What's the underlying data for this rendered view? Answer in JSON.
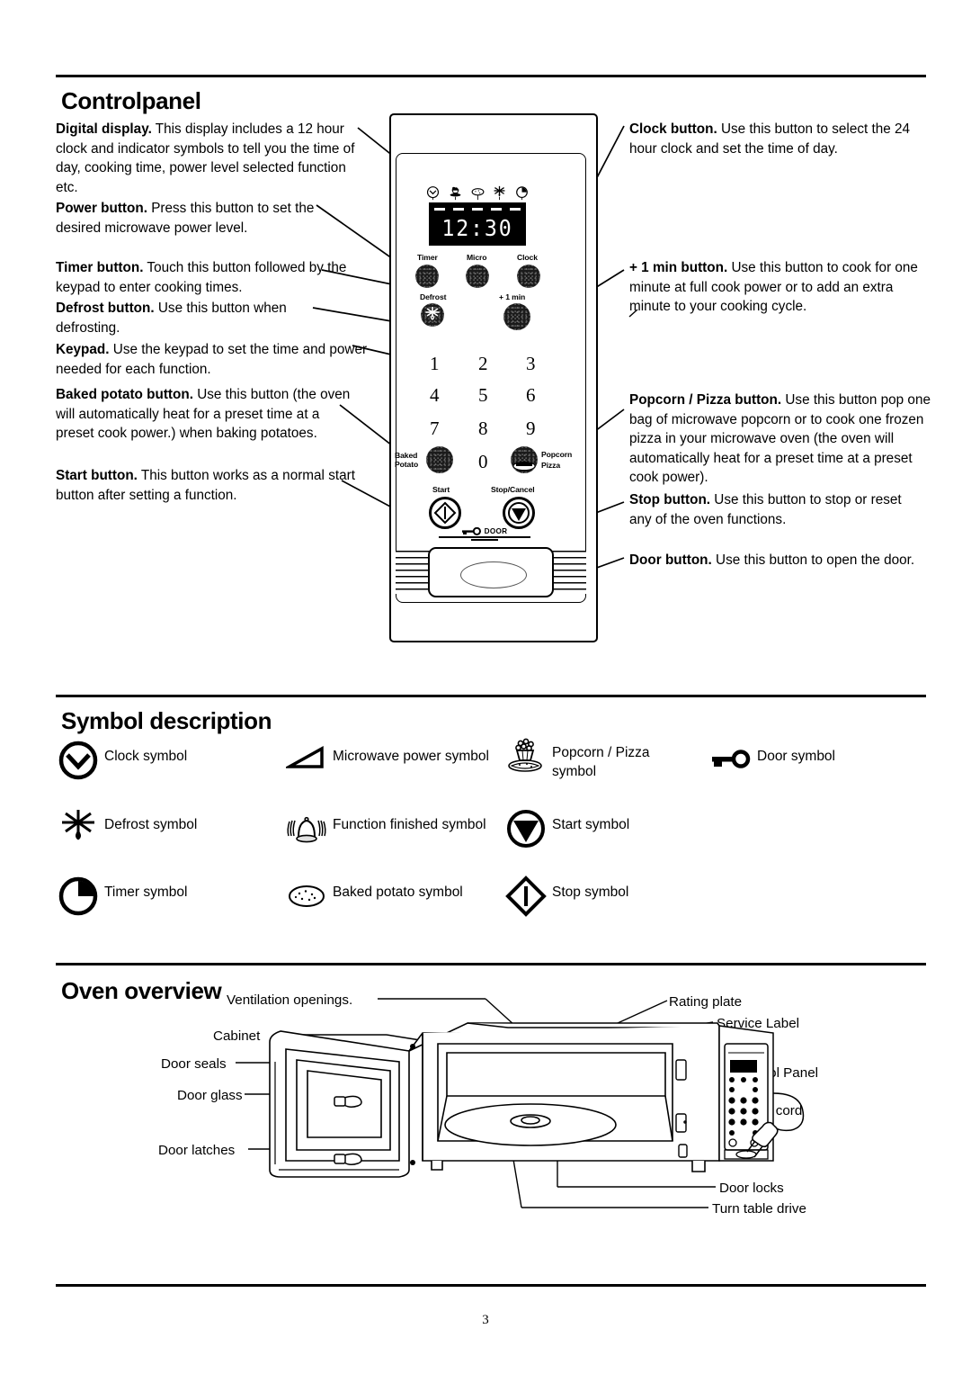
{
  "sections": {
    "control_panel": {
      "title": "Controlpanel",
      "left_items": [
        {
          "term": "Digital display.",
          "desc": " This display includes a 12 hour clock and indicator symbols to tell you the time of day, cooking time, power level selected function etc."
        },
        {
          "term": "Power button.",
          "desc": "  Press this button to set the desired microwave power level."
        },
        {
          "term": "Timer button.",
          "desc": " Touch this button followed by the keypad to enter cooking times."
        },
        {
          "term": "Defrost button.",
          "desc": " Use this button when defrosting."
        },
        {
          "term": "Keypad.",
          "desc": " Use the keypad to set the time and power needed for each function."
        },
        {
          "term": "Baked potato button.",
          "desc": " Use this button (the oven will automatically heat for a preset time at a preset cook power.) when baking potatoes."
        },
        {
          "term": "Start button.",
          "desc": " This button works as a normal start button after setting a function."
        }
      ],
      "right_items": [
        {
          "term": "Clock button.",
          "desc": " Use this button to select the 24 hour clock and set the time of day."
        },
        {
          "term": "+ 1 min button.",
          "desc": " Use this button to cook for one minute at full cook power or to add an extra minute to your cooking cycle."
        },
        {
          "term": "Popcorn / Pizza button.",
          "desc": " Use this button pop one bag of microwave popcorn or to cook one frozen pizza in your microwave oven (the oven will automatically heat for a preset time at a preset cook power)."
        },
        {
          "term": "Stop button.",
          "desc": " Use this button to stop or reset any of the oven functions."
        },
        {
          "term": "Door button.",
          "desc": " Use this button to open the door."
        }
      ],
      "panel": {
        "display_value": "12:30",
        "indicator_symbols": [
          "clock-indicator",
          "popcorn-pizza-indicator",
          "baked-potato-indicator",
          "defrost-indicator",
          "timer-indicator"
        ],
        "buttons": {
          "timer": "Timer",
          "micro": "Micro",
          "clock": "Clock",
          "defrost": "Defrost",
          "plus_one_min": "+ 1 min",
          "baked_potato_l1": "Baked",
          "baked_potato_l2": "Potato",
          "popcorn_l1": "Popcorn",
          "popcorn_l2": "Pizza",
          "start": "Start",
          "stop": "Stop/Cancel",
          "door": "DOOR"
        },
        "keypad": [
          "1",
          "2",
          "3",
          "4",
          "5",
          "6",
          "7",
          "8",
          "9",
          "0"
        ]
      }
    },
    "symbol_description": {
      "title": "Symbol description",
      "symbols": [
        {
          "icon": "clock-symbol",
          "label": "Clock symbol"
        },
        {
          "icon": "microwave-power-symbol",
          "label": "Microwave power symbol"
        },
        {
          "icon": "popcorn-pizza-symbol",
          "label": "Popcorn / Pizza symbol"
        },
        {
          "icon": "door-key-symbol",
          "label": "Door symbol"
        },
        {
          "icon": "defrost-symbol",
          "label": "Defrost symbol"
        },
        {
          "icon": "bell-symbol",
          "label": "Function finished symbol"
        },
        {
          "icon": "start-symbol",
          "label": "Start symbol"
        },
        {
          "icon": "timer-symbol",
          "label": "Timer symbol"
        },
        {
          "icon": "baked-potato-symbol",
          "label": "Baked potato symbol"
        },
        {
          "icon": "stop-symbol",
          "label": "Stop symbol"
        }
      ]
    },
    "oven_overview": {
      "title": "Oven overview",
      "labels": [
        "Ventilation openings.",
        "Cabinet",
        "Door seals",
        "Door glass",
        "Door latches",
        "Rating plate",
        "Service Label",
        "Control Panel",
        "Mains cord",
        "Door locks",
        "Turn table drive"
      ]
    }
  },
  "footer": {
    "page_number": "3"
  },
  "colors": {
    "ink": "#000000",
    "paper": "#ffffff",
    "lcd_bg": "#000000",
    "lcd_fg": "#ffffff"
  }
}
